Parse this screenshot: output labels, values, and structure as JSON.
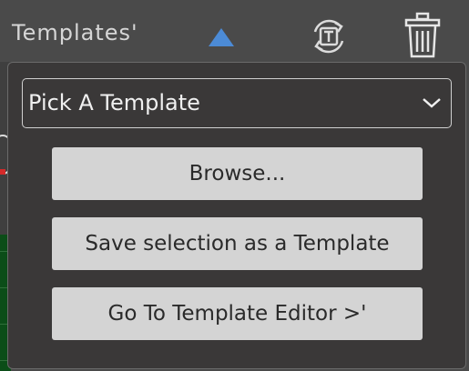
{
  "header": {
    "title": "Templates'",
    "collapse_icon": "triangle-up-icon",
    "refresh_icon": "refresh-template-icon",
    "delete_icon": "trash-icon",
    "accent_color": "#4c8bd6"
  },
  "template_menu": {
    "select": {
      "value": "Pick A Template",
      "icon": "chevron-down-icon"
    },
    "browse_label": "Browse...",
    "save_label": "Save selection as a Template",
    "editor_label": "Go To Template Editor >'"
  }
}
